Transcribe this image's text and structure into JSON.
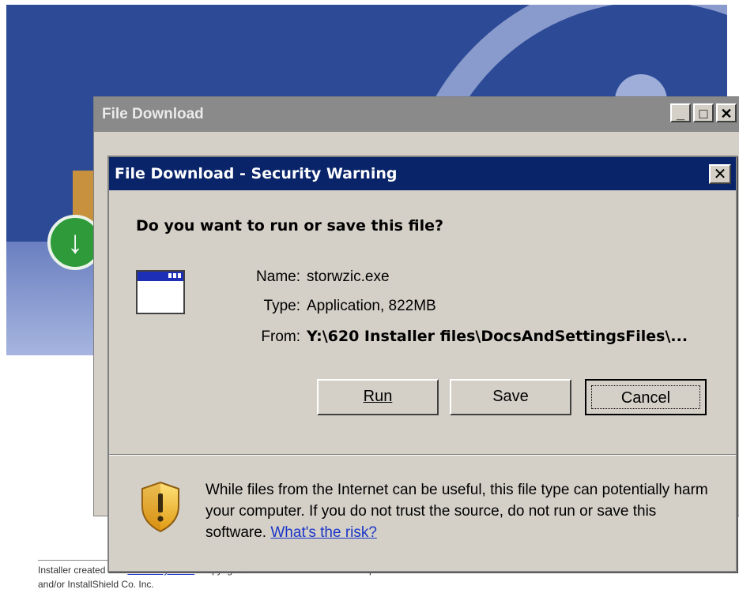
{
  "background": {
    "footer_prefix": "Installer created with ",
    "footer_link": "InstallAnywhere",
    "footer_suffix": ". Copyright © 1997-2005 Macrovision Corporation",
    "footer_line2": "and/or InstallShield Co. Inc."
  },
  "back_dialog": {
    "title": "File Download",
    "buttons": [
      "_",
      "□",
      "✕"
    ]
  },
  "dialog": {
    "title": "File Download - Security Warning",
    "close": "✕",
    "question": "Do you want to run or save this file?",
    "fields": {
      "name_label": "Name:",
      "name_value": "storwzic.exe",
      "type_label": "Type:",
      "type_value": "Application, 822MB",
      "from_label": "From:",
      "from_value": "Y:\\620 Installer files\\DocsAndSettingsFiles\\..."
    },
    "buttons": {
      "run": "Run",
      "save": "Save",
      "cancel": "Cancel"
    },
    "warning": "While files from the Internet can be useful, this file type can potentially harm your computer. If you do not trust the source, do not run or save this software. ",
    "risk_link": "What's the risk?",
    "icons": {
      "app": "application-icon",
      "shield": "shield-warning-icon"
    },
    "colors": {
      "titlebar": "#0a246a",
      "dialog_bg": "#d4d0c8",
      "link": "#1a35c8"
    }
  }
}
